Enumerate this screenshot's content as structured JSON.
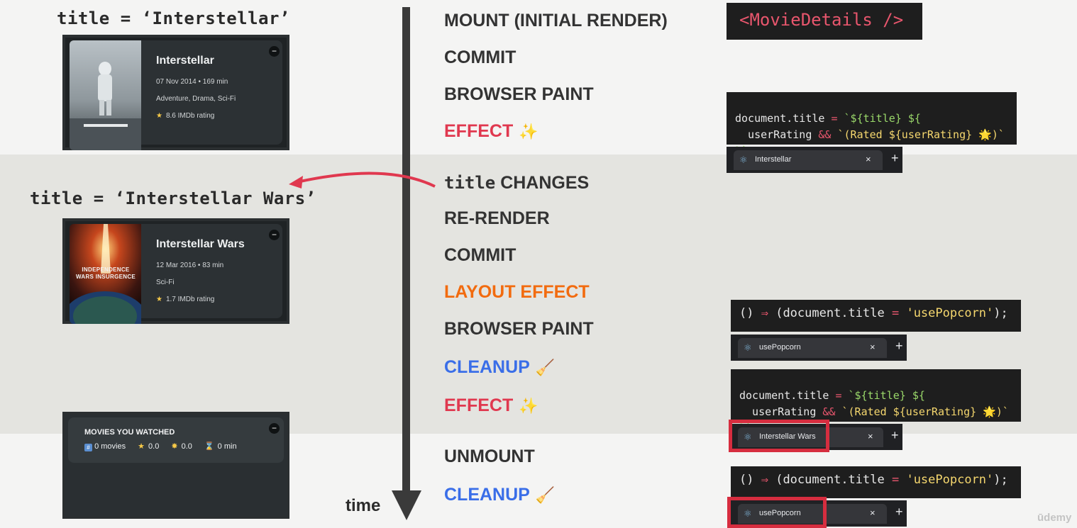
{
  "labels": {
    "title_a": "title = ‘Interstellar’",
    "title_b": "title = ‘Interstellar Wars’",
    "time": "time",
    "component": "<MovieDetails />",
    "brand": "ūdemy"
  },
  "steps": {
    "mount": "MOUNT (INITIAL RENDER)",
    "commit1": "COMMIT",
    "paint1": "BROWSER PAINT",
    "effect1": "EFFECT",
    "effect1_emoji": "✨",
    "title_word": "title",
    "changes": "CHANGES",
    "rerender": "RE-RENDER",
    "commit2": "COMMIT",
    "layout_effect": "LAYOUT EFFECT",
    "paint2": "BROWSER PAINT",
    "cleanup1": "CLEANUP",
    "cleanup1_emoji": "🧹",
    "effect2": "EFFECT",
    "effect2_emoji": "✨",
    "unmount": "UNMOUNT",
    "cleanup2": "CLEANUP",
    "cleanup2_emoji": "🧹"
  },
  "movie1": {
    "title": "Interstellar",
    "date_runtime": "07 Nov 2014 • 169 min",
    "genres": "Adventure, Drama, Sci-Fi",
    "rating": "8.6 IMDb rating",
    "star": "★",
    "remove": "−"
  },
  "movie2": {
    "title": "Interstellar Wars",
    "date_runtime": "12 Mar 2016 • 83 min",
    "genres": "Sci-Fi",
    "rating": "1.7 IMDb rating",
    "star": "★",
    "poster_text": "INDEPENDENCE WARS INSURGENCE",
    "remove": "−"
  },
  "summary": {
    "heading": "MOVIES YOU WATCHED",
    "movies": "0 movies",
    "imdb": "0.0",
    "user": "0.0",
    "runtime": "0 min",
    "remove": "−"
  },
  "code": {
    "effect_l1a": "document.title",
    "effect_l1b": " = ",
    "effect_l1c": "`${title} ${",
    "effect_l2a": "  userRating ",
    "effect_l2b": "&&",
    "effect_l2c": " `(Rated ${userRating} 🌟)`",
    "effect_l3": "}`;",
    "cleanup_a": "() ",
    "cleanup_b": "⇒",
    "cleanup_c": " (document.title ",
    "cleanup_d": "=",
    "cleanup_e": " 'usePopcorn'",
    "cleanup_f": ");"
  },
  "tabs": {
    "t1": "Interstellar",
    "t2": "usePopcorn",
    "t3": "Interstellar Wars",
    "t4": "usePopcorn",
    "close": "×",
    "plus": "+"
  },
  "colors": {
    "effect": "#e0384f",
    "layout_effect": "#f26b0f",
    "cleanup": "#3a6ee8",
    "highlight_box": "#d62d3f"
  }
}
